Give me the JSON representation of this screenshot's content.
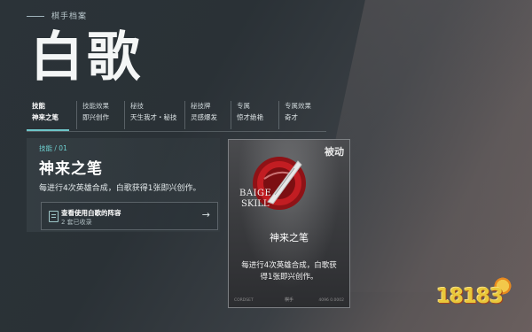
{
  "header": {
    "section_title": "棋手档案"
  },
  "hero": {
    "name": "白歌"
  },
  "tabs": [
    {
      "label": "技能",
      "value": "神来之笔"
    },
    {
      "label": "技能效果",
      "value": "即兴创作"
    },
    {
      "label": "秘技",
      "value": "天生我才・秘技"
    },
    {
      "label": "秘技牌",
      "value": "灵感爆发"
    },
    {
      "label": "专属",
      "value": "惊才绝艳"
    },
    {
      "label": "专属效果",
      "value": "奇才"
    }
  ],
  "skill": {
    "index_label": "技能 / 01",
    "name": "神来之笔",
    "description": "每进行4次英雄合成，白歌获得1张即兴创作。",
    "lineup": {
      "title": "查看使用白歌的阵容",
      "subtitle": "2 套已收录",
      "arrow": "→"
    }
  },
  "card": {
    "tag": "被动",
    "latin_line1": "BAIGE",
    "latin_line2": "SKILL",
    "name": "神来之笔",
    "desc_line1": "每进行4次英雄合成，白歌获",
    "desc_line2": "得1张即兴创作。",
    "footer": "棋手",
    "code_left": "CORDSET",
    "code_right": "4096 0.0002"
  },
  "watermark": {
    "text": "18183"
  },
  "colors": {
    "accent": "#6ec6c9",
    "emblem_red": "#b3171c",
    "logo_yellow": "#e9c83a"
  }
}
